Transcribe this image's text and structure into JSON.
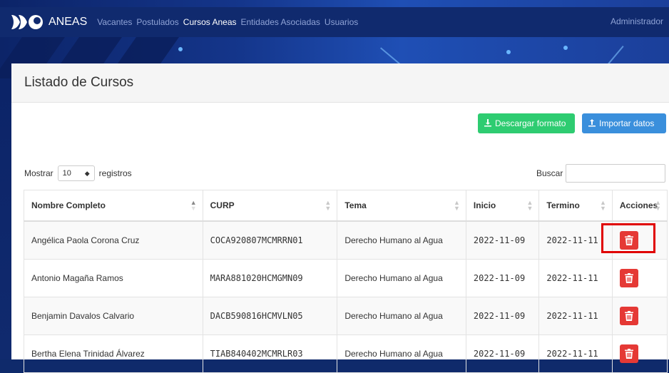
{
  "brand": {
    "name": "ANEAS"
  },
  "nav": {
    "items": [
      {
        "label": "Vacantes",
        "active": false
      },
      {
        "label": "Postulados",
        "active": false
      },
      {
        "label": "Cursos Aneas",
        "active": true
      },
      {
        "label": "Entidades Asociadas",
        "active": false
      },
      {
        "label": "Usuarios",
        "active": false
      }
    ],
    "user": "Administrador"
  },
  "panel": {
    "title": "Listado de Cursos"
  },
  "toolbar": {
    "download_label": "Descargar formato",
    "download_icon": "download-icon",
    "import_label": "Importar datos",
    "import_icon": "upload-icon",
    "download_color": "#2ecc71",
    "import_color": "#3a8fdc"
  },
  "table_controls": {
    "show_label": "Mostrar",
    "page_size": "10",
    "records_label": "registros",
    "search_label": "Buscar",
    "search_value": ""
  },
  "table": {
    "columns": [
      "Nombre Completo",
      "CURP",
      "Tema",
      "Inicio",
      "Termino",
      "Acciones"
    ],
    "rows": [
      {
        "name": "Angélica Paola Corona Cruz",
        "curp": "COCA920807MCMRRN01",
        "tema": "Derecho Humano al Agua",
        "inicio": "2022-11-09",
        "termino": "2022-11-11"
      },
      {
        "name": "Antonio Magaña Ramos",
        "curp": "MARA881020HCMGMN09",
        "tema": "Derecho Humano al Agua",
        "inicio": "2022-11-09",
        "termino": "2022-11-11"
      },
      {
        "name": "Benjamin Davalos Calvario",
        "curp": "DACB590816HCMVLN05",
        "tema": "Derecho Humano al Agua",
        "inicio": "2022-11-09",
        "termino": "2022-11-11"
      },
      {
        "name": "Bertha Elena Trinidad Álvarez",
        "curp": "TIAB840402MCMRLR03",
        "tema": "Derecho Humano al Agua",
        "inicio": "2022-11-09",
        "termino": "2022-11-11"
      }
    ],
    "delete_icon": "trash-icon",
    "delete_color": "#e53935"
  },
  "highlight_color": "#e00000"
}
